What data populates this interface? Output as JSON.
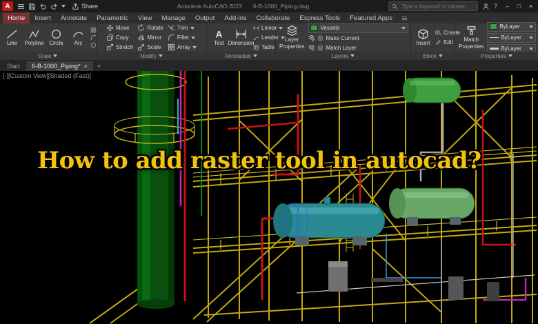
{
  "titlebar": {
    "logo_letter": "A",
    "share_label": "Share",
    "app_name": "Autodesk AutoCAD 2023",
    "doc_name": "6-B-1000_Piping.dwg",
    "search_placeholder": "Type a keyword or phrase",
    "help_glyph": "?",
    "minimize_glyph": "–",
    "maximize_glyph": "□",
    "close_glyph": "×"
  },
  "ribbon_tabs": [
    "Home",
    "Insert",
    "Annotate",
    "Parametric",
    "View",
    "Manage",
    "Output",
    "Add-ins",
    "Collaborate",
    "Express Tools",
    "Featured Apps"
  ],
  "panels": {
    "draw": {
      "label": "Draw",
      "line": "Line",
      "polyline": "Polyline",
      "circle": "Circle",
      "arc": "Arc"
    },
    "modify": {
      "label": "Modify",
      "move": "Move",
      "copy": "Copy",
      "stretch": "Stretch",
      "rotate": "Rotate",
      "mirror": "Mirror",
      "scale": "Scale",
      "trim": "Trim",
      "fillet": "Fillet",
      "array": "Array"
    },
    "annotation": {
      "label": "Annotation",
      "text_tool": "Text",
      "dimension": "Dimension",
      "linear": "Linear",
      "leader": "Leader",
      "table": "Table"
    },
    "layers": {
      "label": "Layers",
      "layer_properties_line1": "Layer",
      "layer_properties_line2": "Properties",
      "current_layer": "Vessels",
      "make_current": "Make Current",
      "match_layer": "Match Layer"
    },
    "block": {
      "label": "Block",
      "insert": "Insert",
      "create": "Create",
      "edit": "Edit"
    },
    "properties": {
      "label": "Properties",
      "match_line1": "Match",
      "match_line2": "Properties",
      "color": "ByLayer",
      "linetype": "ByLayer",
      "lineweight": "ByLayer"
    }
  },
  "file_tabs": {
    "start": "Start",
    "active": "6-B-1000_Piping*",
    "close_glyph": "×",
    "new_glyph": "+"
  },
  "viewport": {
    "menu": "[-]",
    "view": "[Custom View]",
    "shade": "[Shaded (Fast)]"
  },
  "overlay_text": "How to add raster tool in autocad?",
  "palette": {
    "overlay_yellow": "#f2c20e",
    "steel_yellow": "#c4a90e",
    "vessel_teal": "#2a8a92",
    "vessel_green": "#69a766",
    "column_green": "#07500d",
    "pipe_red": "#c41414",
    "pipe_magenta": "#bb2abb",
    "active_tab_red": "#76302f"
  }
}
